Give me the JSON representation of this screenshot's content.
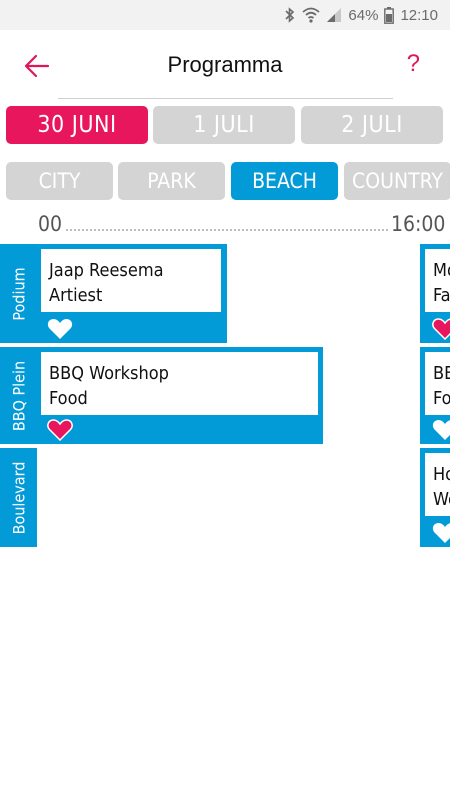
{
  "status_bar": {
    "battery": "64%",
    "time": "12:10",
    "icons": [
      "bluetooth-icon",
      "wifi-icon",
      "signal-icon",
      "battery-icon"
    ]
  },
  "header": {
    "title": "Programma",
    "back_icon": "arrow-left-icon",
    "help": "?"
  },
  "date_tabs": [
    {
      "label": "30 JUNI",
      "active": true
    },
    {
      "label": "1 JULI",
      "active": false
    },
    {
      "label": "2 JULI",
      "active": false
    }
  ],
  "location_tabs": [
    {
      "label": "CITY",
      "active": false
    },
    {
      "label": "PARK",
      "active": false
    },
    {
      "label": "BEACH",
      "active": true
    },
    {
      "label": "COUNTRY",
      "active": false
    }
  ],
  "timeline": {
    "start": "00",
    "end": "16:00"
  },
  "stages": [
    {
      "name": "Podium"
    },
    {
      "name": "BBQ Plein"
    },
    {
      "name": "Boulevard"
    }
  ],
  "events": [
    {
      "title": "Jaap Reesema",
      "category": "Artiest",
      "favorite": false
    },
    {
      "title": "BBQ Workshop",
      "category": "Food",
      "favorite": true
    },
    {
      "title": "Mo",
      "category": "Fa",
      "favorite": true
    },
    {
      "title": "BB",
      "category": "Fo",
      "favorite": false
    },
    {
      "title": "Ho",
      "category": "We",
      "favorite": false
    }
  ],
  "colors": {
    "accent_pink": "#e8175d",
    "accent_blue": "#039ad8",
    "inactive_tab": "#d4d4d4",
    "statusbar_bg": "#f2f2f2"
  }
}
